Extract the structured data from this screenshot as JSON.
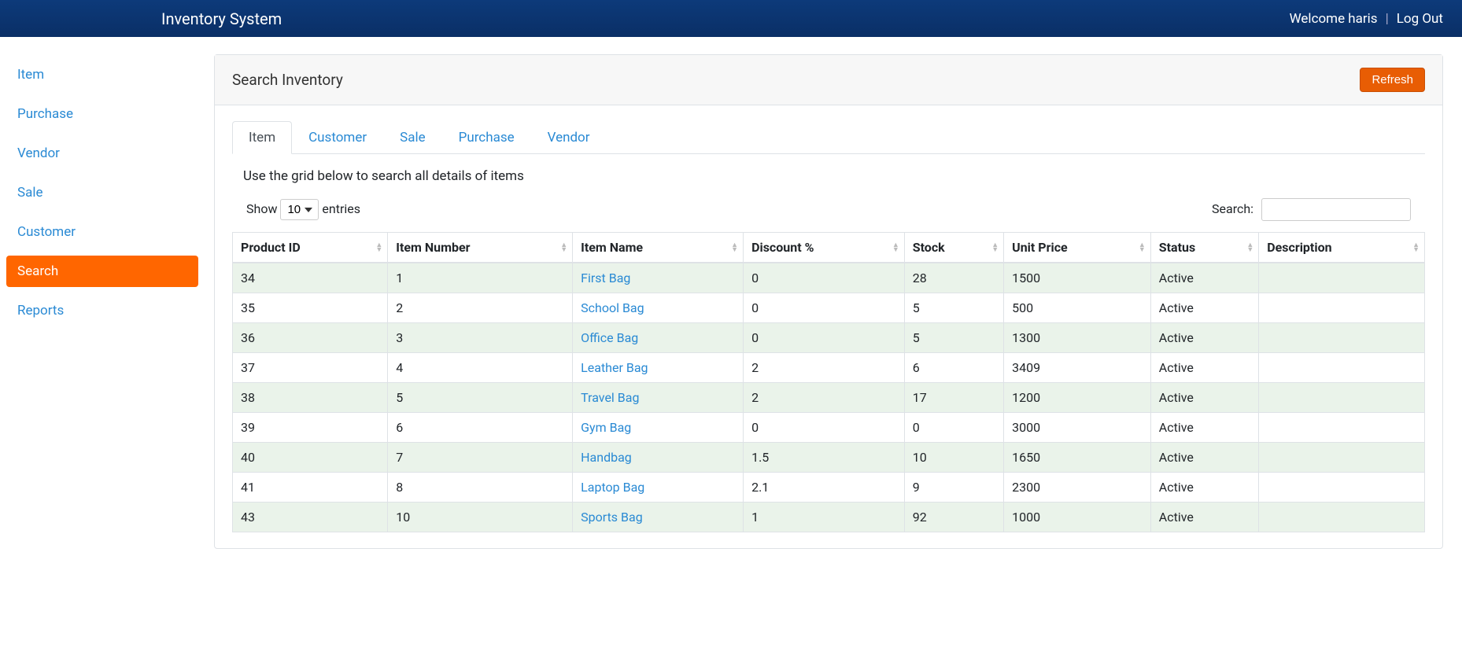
{
  "header": {
    "brand": "Inventory System",
    "welcome": "Welcome haris",
    "logout": "Log Out"
  },
  "sidebar": {
    "items": [
      {
        "label": "Item"
      },
      {
        "label": "Purchase"
      },
      {
        "label": "Vendor"
      },
      {
        "label": "Sale"
      },
      {
        "label": "Customer"
      },
      {
        "label": "Search"
      },
      {
        "label": "Reports"
      }
    ],
    "active_index": 5
  },
  "card": {
    "title": "Search Inventory",
    "refresh": "Refresh"
  },
  "tabs": {
    "items": [
      {
        "label": "Item"
      },
      {
        "label": "Customer"
      },
      {
        "label": "Sale"
      },
      {
        "label": "Purchase"
      },
      {
        "label": "Vendor"
      }
    ],
    "active_index": 0
  },
  "grid_desc": "Use the grid below to search all details of items",
  "table_controls": {
    "show_label_pre": "Show",
    "show_value": "10",
    "show_label_post": "entries",
    "search_label": "Search:"
  },
  "table": {
    "columns": [
      "Product ID",
      "Item Number",
      "Item Name",
      "Discount %",
      "Stock",
      "Unit Price",
      "Status",
      "Description"
    ],
    "rows": [
      {
        "product_id": "34",
        "item_number": "1",
        "item_name": "First Bag",
        "discount": "0",
        "stock": "28",
        "unit_price": "1500",
        "status": "Active",
        "description": ""
      },
      {
        "product_id": "35",
        "item_number": "2",
        "item_name": "School Bag",
        "discount": "0",
        "stock": "5",
        "unit_price": "500",
        "status": "Active",
        "description": ""
      },
      {
        "product_id": "36",
        "item_number": "3",
        "item_name": "Office Bag",
        "discount": "0",
        "stock": "5",
        "unit_price": "1300",
        "status": "Active",
        "description": ""
      },
      {
        "product_id": "37",
        "item_number": "4",
        "item_name": "Leather Bag",
        "discount": "2",
        "stock": "6",
        "unit_price": "3409",
        "status": "Active",
        "description": ""
      },
      {
        "product_id": "38",
        "item_number": "5",
        "item_name": "Travel Bag",
        "discount": "2",
        "stock": "17",
        "unit_price": "1200",
        "status": "Active",
        "description": ""
      },
      {
        "product_id": "39",
        "item_number": "6",
        "item_name": "Gym Bag",
        "discount": "0",
        "stock": "0",
        "unit_price": "3000",
        "status": "Active",
        "description": ""
      },
      {
        "product_id": "40",
        "item_number": "7",
        "item_name": "Handbag",
        "discount": "1.5",
        "stock": "10",
        "unit_price": "1650",
        "status": "Active",
        "description": ""
      },
      {
        "product_id": "41",
        "item_number": "8",
        "item_name": "Laptop Bag",
        "discount": "2.1",
        "stock": "9",
        "unit_price": "2300",
        "status": "Active",
        "description": ""
      },
      {
        "product_id": "43",
        "item_number": "10",
        "item_name": "Sports Bag",
        "discount": "1",
        "stock": "92",
        "unit_price": "1000",
        "status": "Active",
        "description": ""
      }
    ]
  }
}
